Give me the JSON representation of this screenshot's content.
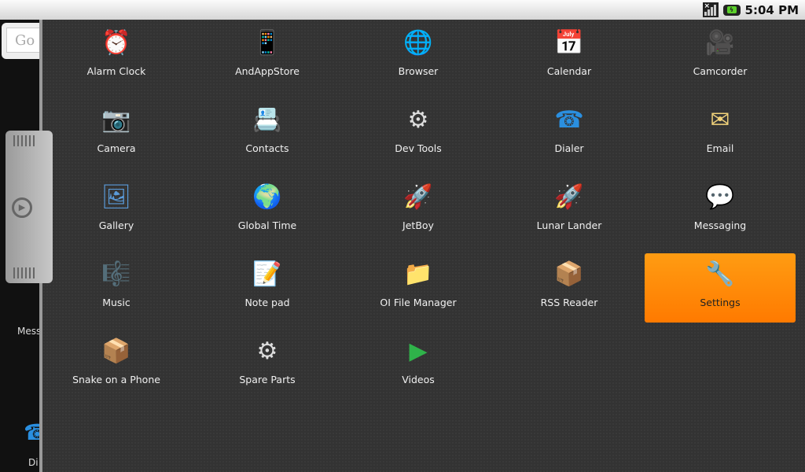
{
  "status_bar": {
    "time": "5:04 PM",
    "signal_icon": "signal-no-service-icon",
    "battery_icon": "battery-charging-icon"
  },
  "home": {
    "search_text": "Go",
    "partial_labels": [
      "Mess",
      "Di"
    ]
  },
  "apps": [
    {
      "label": "Alarm Clock",
      "icon": "⏰",
      "color": "#f39a1b"
    },
    {
      "label": "AndAppStore",
      "icon": "📱",
      "color": "#2b8de0"
    },
    {
      "label": "Browser",
      "icon": "🌐",
      "color": "#2e9b4f"
    },
    {
      "label": "Calendar",
      "icon": "📅",
      "color": "#4a7bc2"
    },
    {
      "label": "Camcorder",
      "icon": "🎥",
      "color": "#cfcfcf"
    },
    {
      "label": "Camera",
      "icon": "📷",
      "color": "#ddd"
    },
    {
      "label": "Contacts",
      "icon": "📇",
      "color": "#e8a85a"
    },
    {
      "label": "Dev Tools",
      "icon": "⚙",
      "color": "#ddd"
    },
    {
      "label": "Dialer",
      "icon": "☎",
      "color": "#2a8fe0"
    },
    {
      "label": "Email",
      "icon": "✉",
      "color": "#f1d27a"
    },
    {
      "label": "Gallery",
      "icon": "🖼",
      "color": "#5a9ad8"
    },
    {
      "label": "Global Time",
      "icon": "🌍",
      "color": "#2e9b4f"
    },
    {
      "label": "JetBoy",
      "icon": "🚀",
      "color": "#c33"
    },
    {
      "label": "Lunar Lander",
      "icon": "🚀",
      "color": "#ccc"
    },
    {
      "label": "Messaging",
      "icon": "💬",
      "color": "#6aa0d8"
    },
    {
      "label": "Music",
      "icon": "🎼",
      "color": "#3cbf8f"
    },
    {
      "label": "Note pad",
      "icon": "📝",
      "color": "#f1e9c0"
    },
    {
      "label": "OI File Manager",
      "icon": "📁",
      "color": "#e6e6e6"
    },
    {
      "label": "RSS Reader",
      "icon": "📦",
      "color": "#8ccc3a"
    },
    {
      "label": "Settings",
      "icon": "🔧",
      "color": "#d33",
      "selected": true
    },
    {
      "label": "Snake on a Phone",
      "icon": "📦",
      "color": "#8ccc3a"
    },
    {
      "label": "Spare Parts",
      "icon": "⚙",
      "color": "#ddd"
    },
    {
      "label": "Videos",
      "icon": "▶",
      "color": "#2fb34a"
    }
  ]
}
